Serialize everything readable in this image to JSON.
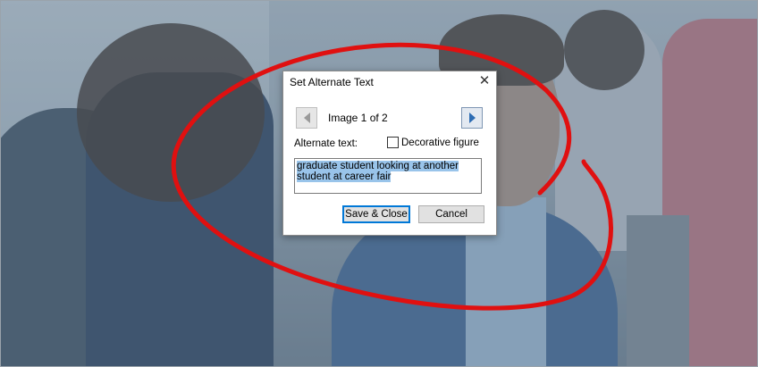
{
  "dialog": {
    "title": "Set Alternate Text",
    "close_glyph": "✕",
    "counter": "Image 1 of 2",
    "alt_label": "Alternate text:",
    "decorative_label": "Decorative figure",
    "decorative_checked": false,
    "alt_value": "graduate student looking at another student at career fair",
    "save_label": "Save & Close",
    "cancel_label": "Cancel"
  },
  "icons": {
    "prev": "previous-arrow-icon",
    "next": "next-arrow-icon",
    "close": "close-icon"
  },
  "colors": {
    "annotation": "#e01010",
    "selection": "#99c4ea",
    "accent": "#0078d7"
  }
}
